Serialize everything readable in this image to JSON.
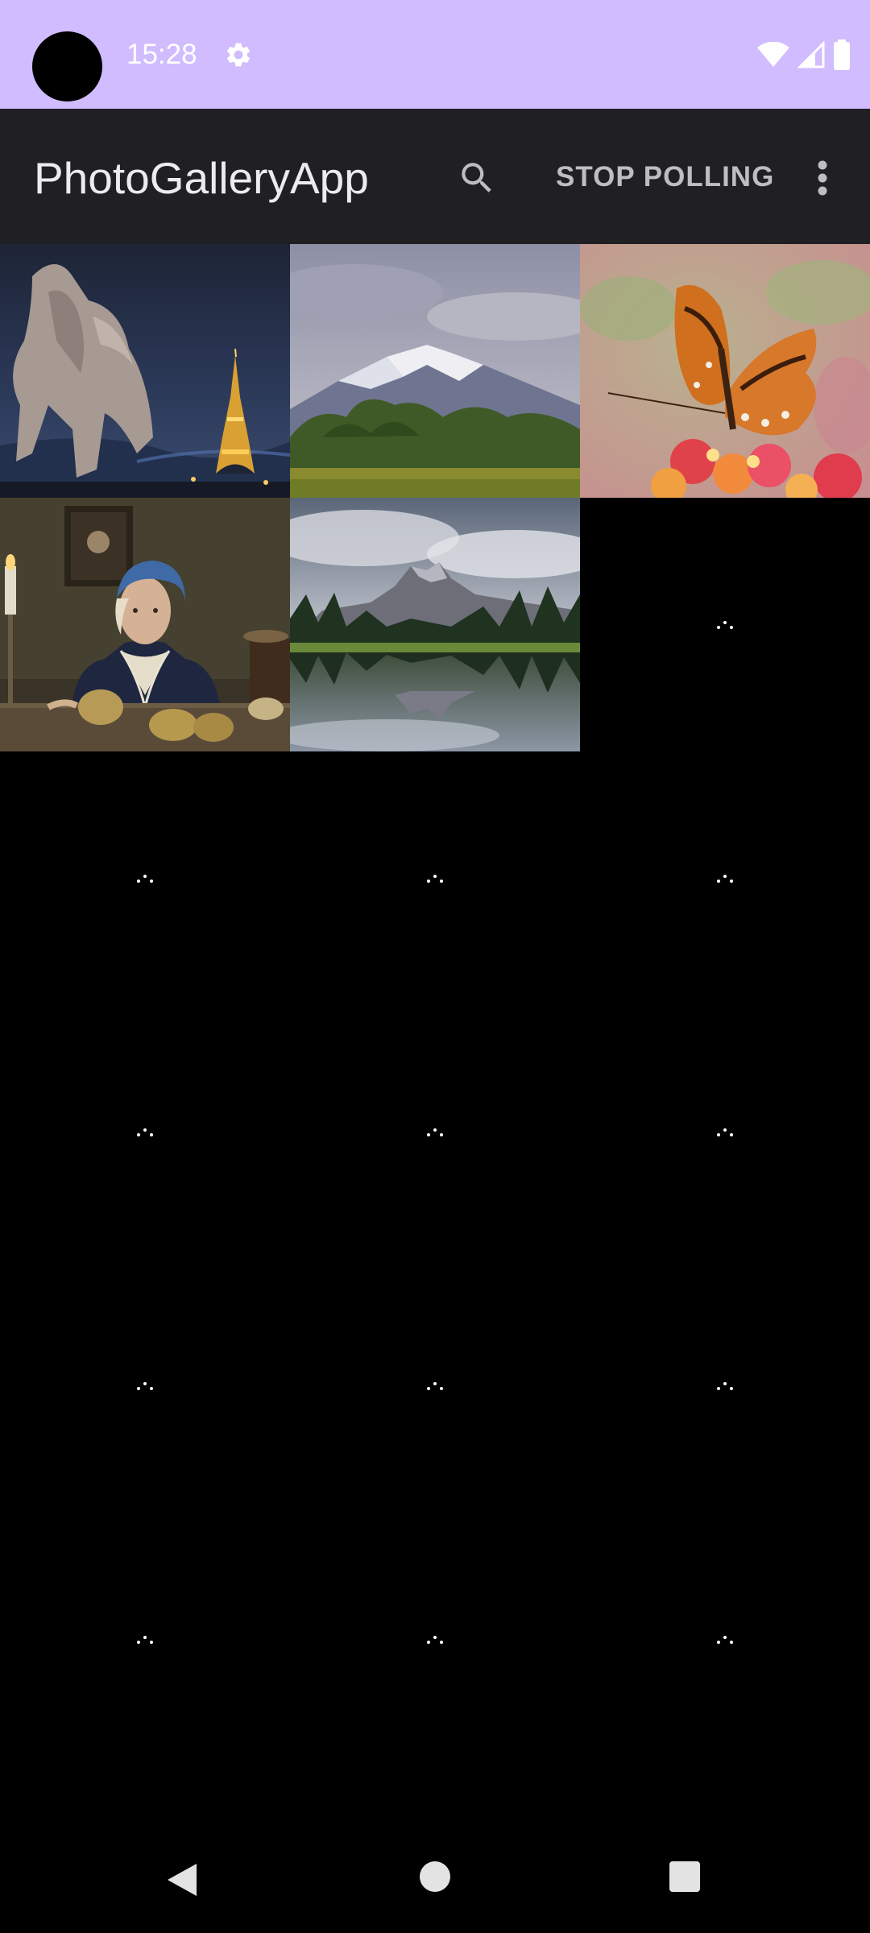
{
  "status_bar": {
    "time": "15:28",
    "icons": [
      "settings-icon",
      "wifi-icon",
      "signal-icon",
      "battery-icon"
    ],
    "background": "#d0bcff"
  },
  "app_bar": {
    "title": "PhotoGalleryApp",
    "search_icon": "search-icon",
    "stop_polling_label": "STOP POLLING",
    "overflow_icon": "more-vert-icon",
    "background": "#1f1f24"
  },
  "gallery": {
    "photos": [
      {
        "subject": "statue-eiffel-tower-night"
      },
      {
        "subject": "snowy-mountain-meadow"
      },
      {
        "subject": "orange-butterfly-flowers"
      },
      {
        "subject": "girl-potatoes-painting"
      },
      {
        "subject": "mountain-lake-reflection"
      }
    ],
    "placeholder_count": 13,
    "placeholder_icon": "loading-dots-icon"
  },
  "nav_bar": {
    "icons": [
      "back-icon",
      "home-icon",
      "recents-icon"
    ]
  }
}
